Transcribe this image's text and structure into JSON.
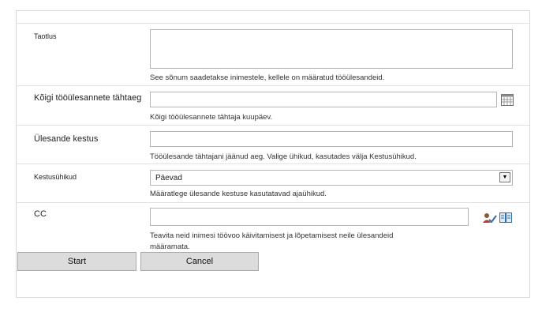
{
  "form": {
    "fields": [
      {
        "label": "Taotlus",
        "description": "See sõnum saadetakse inimestele, kellele on määratud tööülesandeid.",
        "value": ""
      },
      {
        "label": "Kõigi tööülesannete tähtaeg",
        "description": "Kõigi tööülesannete tähtaja kuupäev.",
        "value": ""
      },
      {
        "label": "Ülesande kestus",
        "description": "Tööülesande tähtajani jäänud aeg. Valige ühikud, kasutades välja Kestusühikud.",
        "value": ""
      },
      {
        "label": "Kestusühikud",
        "description": "Määratlege ülesande kestuse kasutatavad ajaühikud.",
        "selected": "Päevad"
      },
      {
        "label": "CC",
        "description_line1": "Teavita neid inimesi töövoo käivitamisest ja lõpetamisest neile ülesandeid",
        "description_line2": "määramata.",
        "value": ""
      }
    ],
    "icons": {
      "calendar": "calendar-icon",
      "check_names": "check-names-icon",
      "address_book": "address-book-icon"
    }
  },
  "buttons": {
    "start": "Start",
    "cancel": "Cancel"
  }
}
